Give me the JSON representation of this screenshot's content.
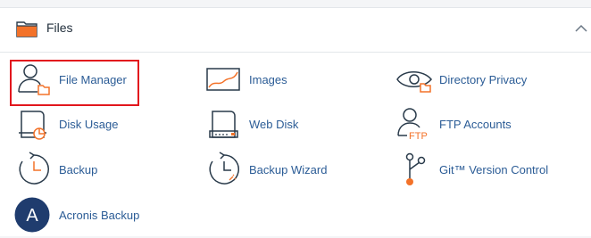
{
  "section": {
    "title": "Files",
    "accent_color": "#f37229",
    "icon": "folder-icon",
    "collapse_icon": "chevron-up-icon"
  },
  "items": [
    {
      "label": "File Manager",
      "icon": "file-manager-icon",
      "selected": true
    },
    {
      "label": "Images",
      "icon": "images-icon"
    },
    {
      "label": "Directory Privacy",
      "icon": "directory-privacy-icon"
    },
    {
      "label": "Disk Usage",
      "icon": "disk-usage-icon"
    },
    {
      "label": "Web Disk",
      "icon": "web-disk-icon"
    },
    {
      "label": "FTP Accounts",
      "icon": "ftp-accounts-icon",
      "icon_text": "FTP"
    },
    {
      "label": "Backup",
      "icon": "backup-icon"
    },
    {
      "label": "Backup Wizard",
      "icon": "backup-wizard-icon"
    },
    {
      "label": "Git™ Version Control",
      "icon": "git-icon"
    },
    {
      "label": "Acronis Backup",
      "icon": "acronis-icon",
      "icon_text": "A"
    }
  ],
  "colors": {
    "link": "#2b5c96",
    "icon_stroke": "#293a4a",
    "icon_accent": "#f37229",
    "highlight": "#e2161d",
    "acronis_bg": "#1f3c6e"
  }
}
